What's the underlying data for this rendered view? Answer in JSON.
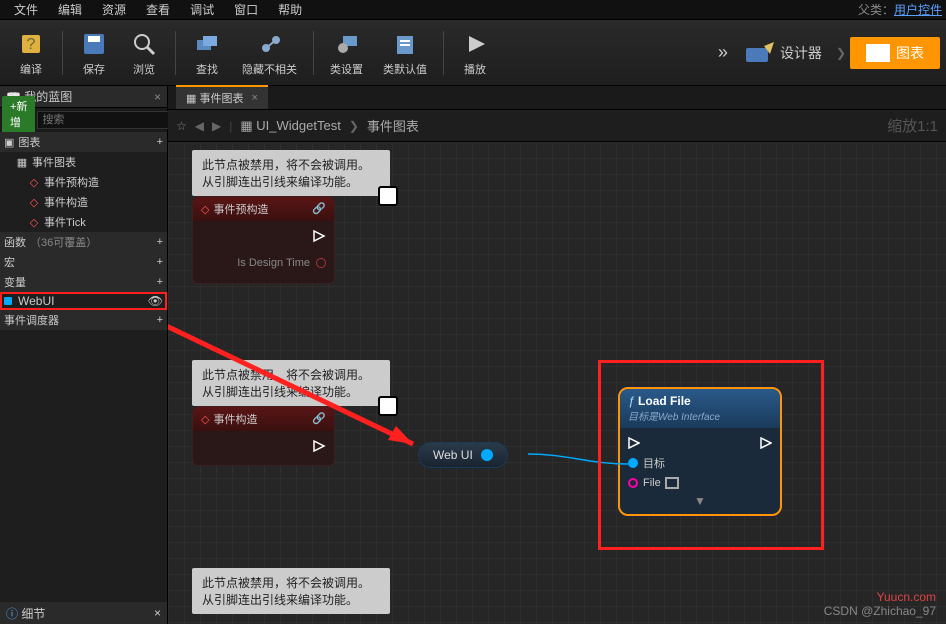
{
  "menu": {
    "file": "文件",
    "edit": "编辑",
    "resource": "资源",
    "view": "查看",
    "debug": "调试",
    "window": "窗口",
    "help": "帮助"
  },
  "parent_class": {
    "label": "父类：",
    "value": "用户控件"
  },
  "toolbar": {
    "compile": "编译",
    "save": "保存",
    "browse": "浏览",
    "find": "查找",
    "hide": "隐藏不相关",
    "class_settings": "类设置",
    "class_defaults": "类默认值",
    "play": "播放",
    "designer": "设计器",
    "graph": "图表"
  },
  "left": {
    "tab": "我的蓝图",
    "add": "+新增",
    "search_placeholder": "搜索",
    "graph_section": "图表",
    "event_graph": "事件图表",
    "event_preconstruct": "事件预构造",
    "event_construct": "事件构造",
    "event_tick": "事件Tick",
    "functions": "函数",
    "functions_hint": "（36可覆盖）",
    "macros": "宏",
    "variables": "变量",
    "webui": "WebUI",
    "dispatchers": "事件调度器",
    "details": "细节"
  },
  "graph": {
    "tab": "事件图表",
    "bc_asset": "UI_WidgetTest",
    "bc_graph": "事件图表",
    "zoom": "缩放1:1",
    "note_line1": "此节点被禁用，将不会被调用。",
    "note_line2": "从引脚连出引线来编译功能。",
    "event_preconstruct": "事件预构造",
    "is_design_time": "Is Design Time",
    "event_construct": "事件构造",
    "webui_node": "Web UI",
    "load_file": {
      "title": "Load File",
      "subtitle": "目标是Web Interface",
      "target": "目标",
      "file": "File"
    }
  },
  "watermark": {
    "yuucn": "Yuucn.com",
    "csdn": "CSDN @Zhichao_97"
  }
}
